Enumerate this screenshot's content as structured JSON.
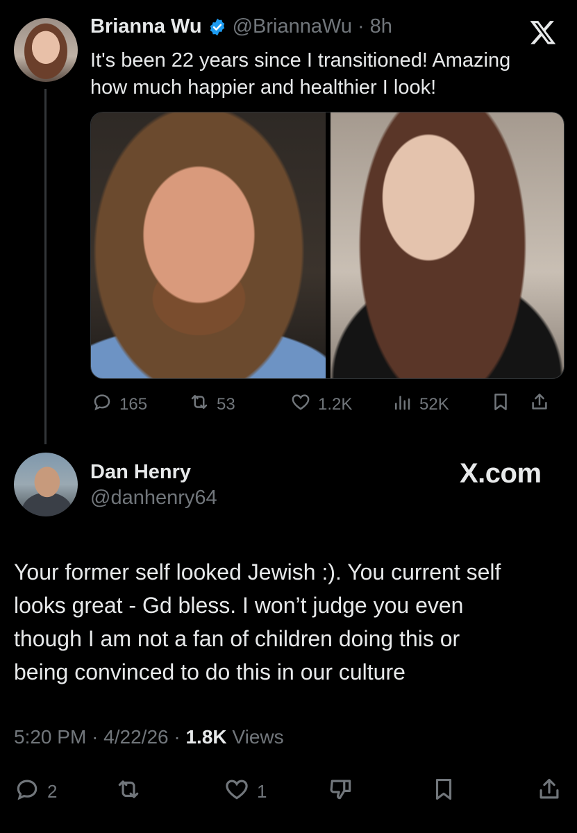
{
  "tweet": {
    "author_name": "Brianna Wu",
    "verified": true,
    "handle": "@BriannaWu",
    "separator": "·",
    "time_ago": "8h",
    "text_line1": "It's been 22 years since I transitioned! Amazing",
    "text_line2": "how much happier and healthier I look!",
    "stats": {
      "replies": "165",
      "reposts": "53",
      "likes": "1.2K",
      "views": "52K"
    }
  },
  "reply": {
    "author_name": "Dan Henry",
    "handle": "@danhenry64",
    "watermark": "X.com",
    "text_lines": [
      "Your former self looked Jewish :). You current self",
      "looks great - Gd bless. I won’t judge you even",
      "though I am not a fan of children doing this or",
      "being convinced to do this in our culture"
    ],
    "time": "5:20 PM",
    "dot": "·",
    "date": "4/22/26",
    "views_count": "1.8K",
    "views_label": "Views",
    "stats": {
      "replies": "2",
      "likes": "1"
    }
  },
  "colors": {
    "background": "#000000",
    "text": "#e7e9ea",
    "muted": "#71767b",
    "verified": "#1d9bf0"
  }
}
